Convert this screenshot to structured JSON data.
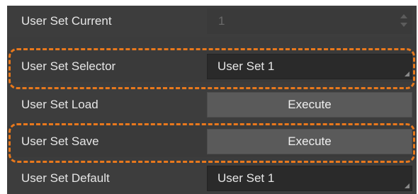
{
  "properties": {
    "user_set_current": {
      "label": "User Set Current",
      "value": "1"
    },
    "user_set_selector": {
      "label": "User Set Selector",
      "value": "User Set 1"
    },
    "user_set_load": {
      "label": "User Set Load",
      "button_label": "Execute"
    },
    "user_set_save": {
      "label": "User Set Save",
      "button_label": "Execute"
    },
    "user_set_default": {
      "label": "User Set Default",
      "value": "User Set 1"
    }
  },
  "icons": {
    "spin_arrows": "up-down-arrow-icon",
    "combo_grip": "dropdown-corner-icon"
  },
  "colors": {
    "panel_background": "#3c3c3c",
    "combo_background": "#2a2a2a",
    "button_background": "#5a5a5a",
    "highlight": "#e8781c",
    "disabled_text": "#6a6a6a",
    "text": "#e6e6e6"
  }
}
